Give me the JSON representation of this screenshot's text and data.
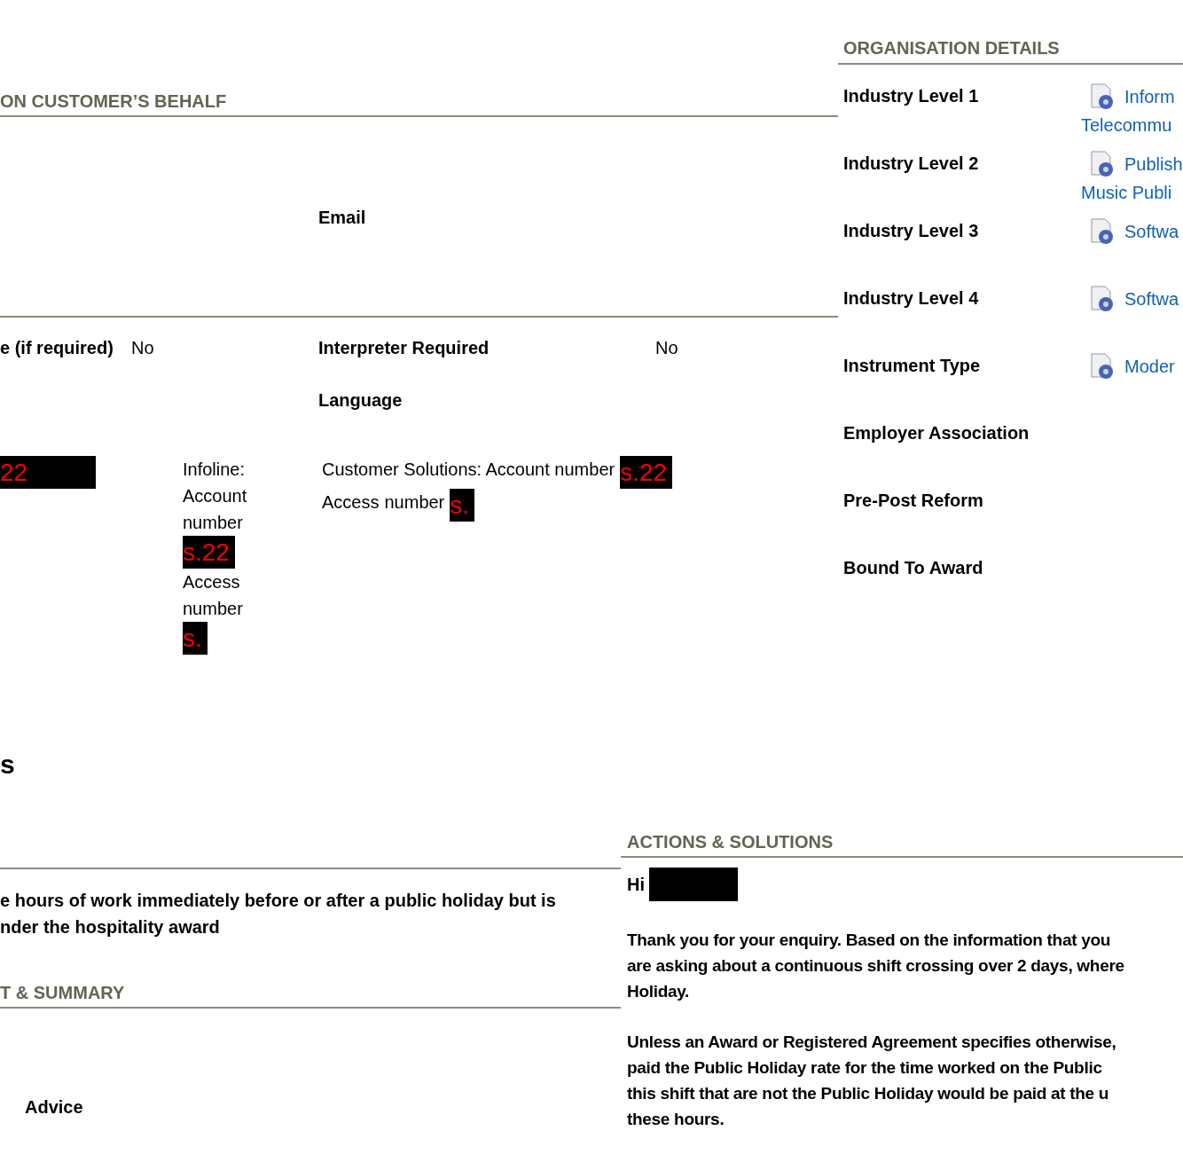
{
  "customer_section": {
    "heading": "ON CUSTOMER’S BEHALF",
    "email_label": "Email"
  },
  "interpreter_row": {
    "cut_label": "e (if required)",
    "cut_value": "No",
    "label": "Interpreter Required",
    "value": "No",
    "language_label": "Language"
  },
  "contact_row": {
    "cut_value": [
      {
        "kind": "redaction",
        "text": "22"
      }
    ],
    "infoline": [
      {
        "kind": "text",
        "text": "Infoline: Account number"
      },
      {
        "kind": "redaction",
        "text": "s.22"
      },
      {
        "kind": "text",
        "text": "Access number"
      },
      {
        "kind": "redaction",
        "text": "s."
      }
    ],
    "customer_solutions": [
      {
        "kind": "text",
        "text": "Customer Solutions: Account number"
      },
      {
        "kind": "redaction",
        "text": "s.22"
      },
      {
        "kind": "text",
        "text": "Access"
      },
      {
        "kind": "text",
        "text": "number"
      },
      {
        "kind": "redaction",
        "text": "s."
      }
    ]
  },
  "section_title": "s",
  "organisation_details": {
    "heading": "ORGANISATION DETAILS",
    "rows": [
      {
        "label": "Industry Level 1",
        "value_lines": [
          "Inform",
          "Telecommu"
        ]
      },
      {
        "label": "Industry Level 2",
        "value_lines": [
          "Publish",
          "Music Publi"
        ]
      },
      {
        "label": "Industry Level 3",
        "value_lines": [
          "Softwa"
        ]
      },
      {
        "label": "Industry Level 4",
        "value_lines": [
          "Softwa"
        ]
      },
      {
        "label": "Instrument Type",
        "value_lines": [
          "Moder"
        ]
      },
      {
        "label": "Employer Association",
        "value_lines": []
      },
      {
        "label": "Pre-Post Reform",
        "value_lines": []
      },
      {
        "label": "Bound To Award",
        "value_lines": []
      }
    ]
  },
  "enquiry": {
    "lines": [
      "e hours of work immediately before or after a public holiday but is",
      "nder the hospitality award"
    ]
  },
  "summary_section": {
    "heading": "T & SUMMARY",
    "value": "Advice"
  },
  "actions_section": {
    "heading": "ACTIONS & SOLUTIONS",
    "greeting": "Hi",
    "greeting_redaction": {
      "kind": "redaction"
    },
    "paragraphs": [
      [
        "Thank you for your enquiry. Based on the information that you",
        "are asking about a continuous shift crossing over 2 days, where",
        "Holiday."
      ],
      [
        "Unless an Award or Registered Agreement specifies otherwise,",
        "paid the Public Holiday rate for the time worked on the Public",
        "this shift that are not the Public Holiday would be paid at the u",
        "these hours."
      ]
    ]
  }
}
